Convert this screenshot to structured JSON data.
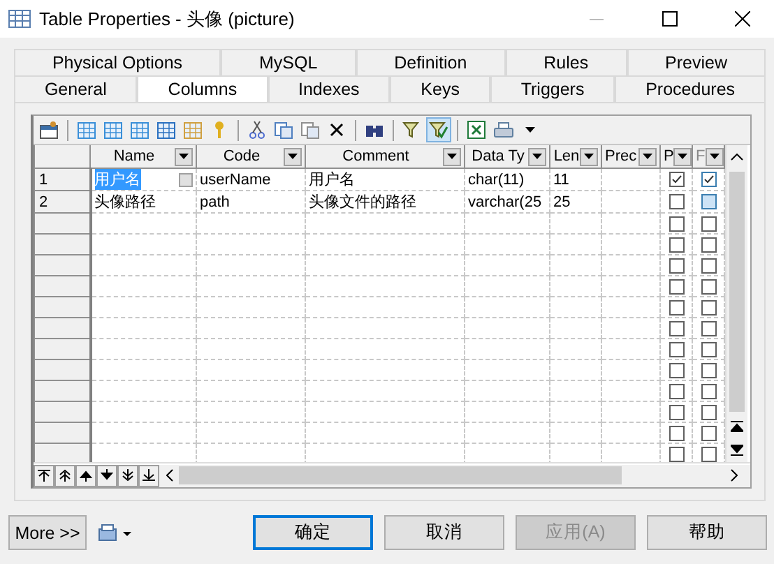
{
  "window": {
    "title": "Table Properties - 头像 (picture)"
  },
  "tab_rows": [
    {
      "tabs": [
        {
          "label": "Physical Options",
          "selected": false
        },
        {
          "label": "MySQL",
          "selected": false
        },
        {
          "label": "Definition",
          "selected": false
        },
        {
          "label": "Rules",
          "selected": false
        },
        {
          "label": "Preview",
          "selected": false
        }
      ]
    },
    {
      "tabs": [
        {
          "label": "General",
          "selected": false
        },
        {
          "label": "Columns",
          "selected": true
        },
        {
          "label": "Indexes",
          "selected": false
        },
        {
          "label": "Keys",
          "selected": false
        },
        {
          "label": "Triggers",
          "selected": false
        },
        {
          "label": "Procedures",
          "selected": false
        }
      ]
    }
  ],
  "toolbar": [
    {
      "kind": "properties",
      "selected": false
    },
    {
      "kind": "sep"
    },
    {
      "kind": "insert-row",
      "selected": false
    },
    {
      "kind": "add-row",
      "selected": false
    },
    {
      "kind": "add-columns",
      "selected": false
    },
    {
      "kind": "replicate",
      "selected": false
    },
    {
      "kind": "domain",
      "selected": false
    },
    {
      "kind": "key",
      "selected": false
    },
    {
      "kind": "sep"
    },
    {
      "kind": "cut",
      "selected": false
    },
    {
      "kind": "copy",
      "selected": false
    },
    {
      "kind": "paste",
      "selected": false
    },
    {
      "kind": "delete",
      "selected": false
    },
    {
      "kind": "sep"
    },
    {
      "kind": "find",
      "selected": false
    },
    {
      "kind": "sep"
    },
    {
      "kind": "filter",
      "selected": false
    },
    {
      "kind": "filter-check",
      "selected": true
    },
    {
      "kind": "sep"
    },
    {
      "kind": "excel",
      "selected": false
    },
    {
      "kind": "print",
      "selected": false
    },
    {
      "kind": "caret"
    }
  ],
  "table": {
    "columns": [
      "Name",
      "Code",
      "Comment",
      "Data Ty",
      "Len",
      "Prec",
      "P",
      "F"
    ],
    "rows": [
      {
        "kind": "data",
        "number": "1",
        "cells": [
          "用户名",
          "userName",
          "用户名",
          "char(11)",
          "11",
          ""
        ],
        "name_selected": true,
        "p_checked": true,
        "f_checked": true
      },
      {
        "kind": "data",
        "number": "2",
        "cells": [
          "头像路径",
          "path",
          "头像文件的路径",
          "varchar(25",
          "25",
          ""
        ],
        "name_selected": false,
        "p_checked": false,
        "f_checked": false
      },
      {
        "kind": "empty",
        "p_checked": false,
        "f_checked": false
      },
      {
        "kind": "empty",
        "p_checked": false,
        "f_checked": false
      },
      {
        "kind": "empty",
        "p_checked": false,
        "f_checked": false
      },
      {
        "kind": "empty",
        "p_checked": false,
        "f_checked": false
      },
      {
        "kind": "empty",
        "p_checked": false,
        "f_checked": false
      },
      {
        "kind": "empty",
        "p_checked": false,
        "f_checked": false
      },
      {
        "kind": "empty",
        "p_checked": false,
        "f_checked": false
      },
      {
        "kind": "empty",
        "p_checked": false,
        "f_checked": false
      },
      {
        "kind": "empty",
        "p_checked": false,
        "f_checked": false
      },
      {
        "kind": "empty",
        "p_checked": false,
        "f_checked": false
      },
      {
        "kind": "empty",
        "p_checked": false,
        "f_checked": false
      },
      {
        "kind": "empty",
        "p_checked": false,
        "f_checked": false
      }
    ]
  },
  "buttons": [
    {
      "label": "More >>",
      "kind": "more",
      "disabled": false
    },
    {
      "label": "确定",
      "kind": "default",
      "disabled": false
    },
    {
      "label": "取消",
      "kind": "normal",
      "disabled": false
    },
    {
      "label": "应用(A)",
      "kind": "normal",
      "disabled": true
    },
    {
      "label": "帮助",
      "kind": "normal",
      "disabled": false
    }
  ]
}
